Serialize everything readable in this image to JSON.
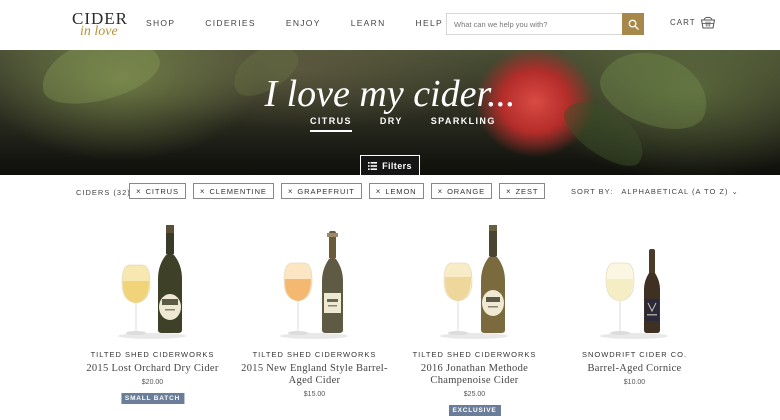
{
  "header": {
    "logo": {
      "top": "CIDER",
      "bottom": "in love"
    },
    "nav": [
      "SHOP",
      "CIDERIES",
      "ENJOY",
      "LEARN",
      "HELP"
    ],
    "search": {
      "placeholder": "What can we help you with?",
      "icon": "search-icon"
    },
    "cart": {
      "label": "CART",
      "icon": "basket-icon"
    }
  },
  "hero": {
    "title": "I love my cider...",
    "tabs": [
      {
        "label": "CITRUS",
        "active": true
      },
      {
        "label": "DRY",
        "active": false
      },
      {
        "label": "SPARKLING",
        "active": false
      }
    ],
    "filters_button": "Filters"
  },
  "filters": {
    "count_label": "CIDERS (32)",
    "chips": [
      "CITRUS",
      "CLEMENTINE",
      "GRAPEFRUIT",
      "LEMON",
      "ORANGE",
      "ZEST"
    ],
    "chip_remove_glyph": "×",
    "sort_label": "SORT BY:",
    "sort_value": "ALPHABETICAL (A TO Z) ⌄"
  },
  "products": [
    {
      "brand": "TILTED SHED CIDERWORKS",
      "name": "2015 Lost Orchard Dry Cider",
      "price": "$20.00",
      "badge": "SMALL BATCH"
    },
    {
      "brand": "TILTED SHED CIDERWORKS",
      "name": "2015 New England Style Barrel-Aged Cider",
      "price": "$15.00",
      "badge": ""
    },
    {
      "brand": "TILTED SHED CIDERWORKS",
      "name": "2016 Jonathan Methode Champenoise Cider",
      "price": "$25.00",
      "badge": "EXCLUSIVE"
    },
    {
      "brand": "SNOWDRIFT CIDER CO.",
      "name": "Barrel-Aged Cornice",
      "price": "$10.00",
      "badge": ""
    }
  ],
  "colors": {
    "accent": "#a8874a",
    "badge": "#6a7d99",
    "logo_script": "#b8923a"
  }
}
